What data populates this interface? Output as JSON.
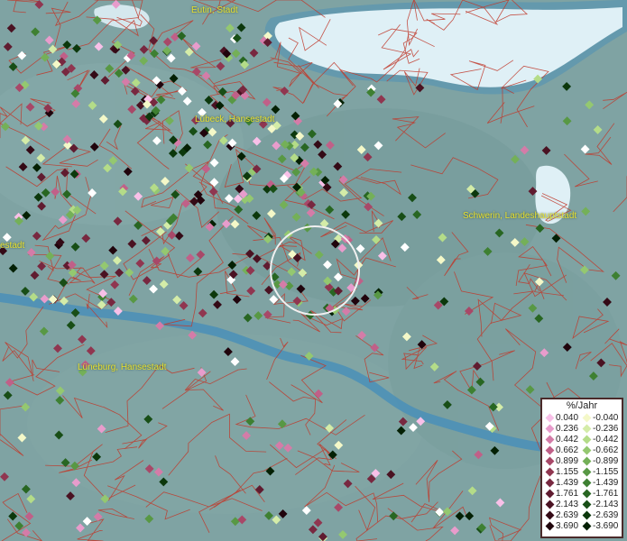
{
  "map": {
    "cities": [
      {
        "id": "eutin",
        "label": "Eutin, Stadt"
      },
      {
        "id": "luebeck",
        "label": "Lübeck, Hansestadt"
      },
      {
        "id": "schwerin",
        "label": "Schwerin, Landeshauptstadt"
      },
      {
        "id": "hamburg",
        "label": "estadt"
      },
      {
        "id": "lueneburg",
        "label": "Lüneburg, Hansestadt"
      }
    ],
    "colors": {
      "land": "#7fa3a3",
      "water": "#dff0f6",
      "river": "#4a8fb8",
      "boundary": "#c0392b",
      "selection_ring": "#f0f0f0"
    }
  },
  "legend": {
    "title": "%/Jahr",
    "positive": [
      {
        "value": "0.040",
        "color": "#f8c0e8"
      },
      {
        "value": "0.236",
        "color": "#e89ccc"
      },
      {
        "value": "0.442",
        "color": "#d47ca8"
      },
      {
        "value": "0.662",
        "color": "#c06088"
      },
      {
        "value": "0.899",
        "color": "#a84868"
      },
      {
        "value": "1.155",
        "color": "#903650"
      },
      {
        "value": "1.439",
        "color": "#782840"
      },
      {
        "value": "1.761",
        "color": "#601c30"
      },
      {
        "value": "2.143",
        "color": "#4a1222"
      },
      {
        "value": "2.639",
        "color": "#340a16"
      },
      {
        "value": "3.690",
        "color": "#20040c"
      }
    ],
    "negative": [
      {
        "value": "-0.040",
        "color": "#f4f8c8"
      },
      {
        "value": "-0.236",
        "color": "#d4eca8"
      },
      {
        "value": "-0.442",
        "color": "#b4dc88"
      },
      {
        "value": "-0.662",
        "color": "#94c870"
      },
      {
        "value": "-0.899",
        "color": "#74b058"
      },
      {
        "value": "-1.155",
        "color": "#589844"
      },
      {
        "value": "-1.439",
        "color": "#3e8032"
      },
      {
        "value": "-1.761",
        "color": "#286622"
      },
      {
        "value": "-2.143",
        "color": "#184e16"
      },
      {
        "value": "-2.639",
        "color": "#0c380c"
      },
      {
        "value": "-3.690",
        "color": "#042004"
      }
    ]
  }
}
